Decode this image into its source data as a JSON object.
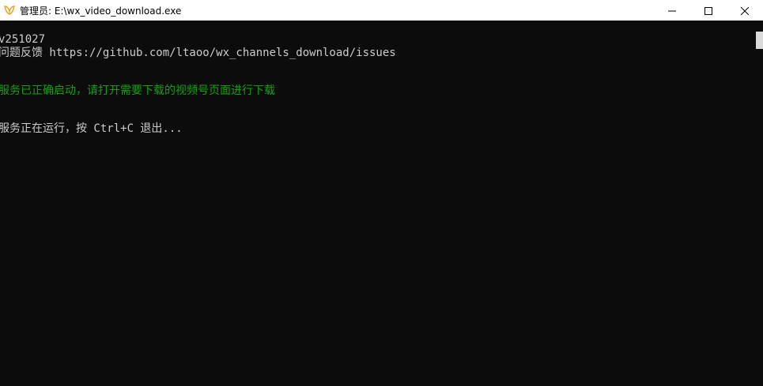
{
  "window": {
    "title": "管理员: E:\\wx_video_download.exe"
  },
  "colors": {
    "console_bg": "#0c0c0c",
    "default_text": "#cccccc",
    "success_text": "#13a10e"
  },
  "icons": {
    "app": "app-icon",
    "minimize": "minimize-icon",
    "maximize": "maximize-icon",
    "close": "close-icon"
  },
  "console": {
    "lines": [
      "v251027",
      "问题反馈 https://github.com/ltaoo/wx_channels_download/issues",
      "服务已正确启动，请打开需要下载的视频号页面进行下载",
      "服务正在运行，按 Ctrl+C 退出..."
    ]
  }
}
